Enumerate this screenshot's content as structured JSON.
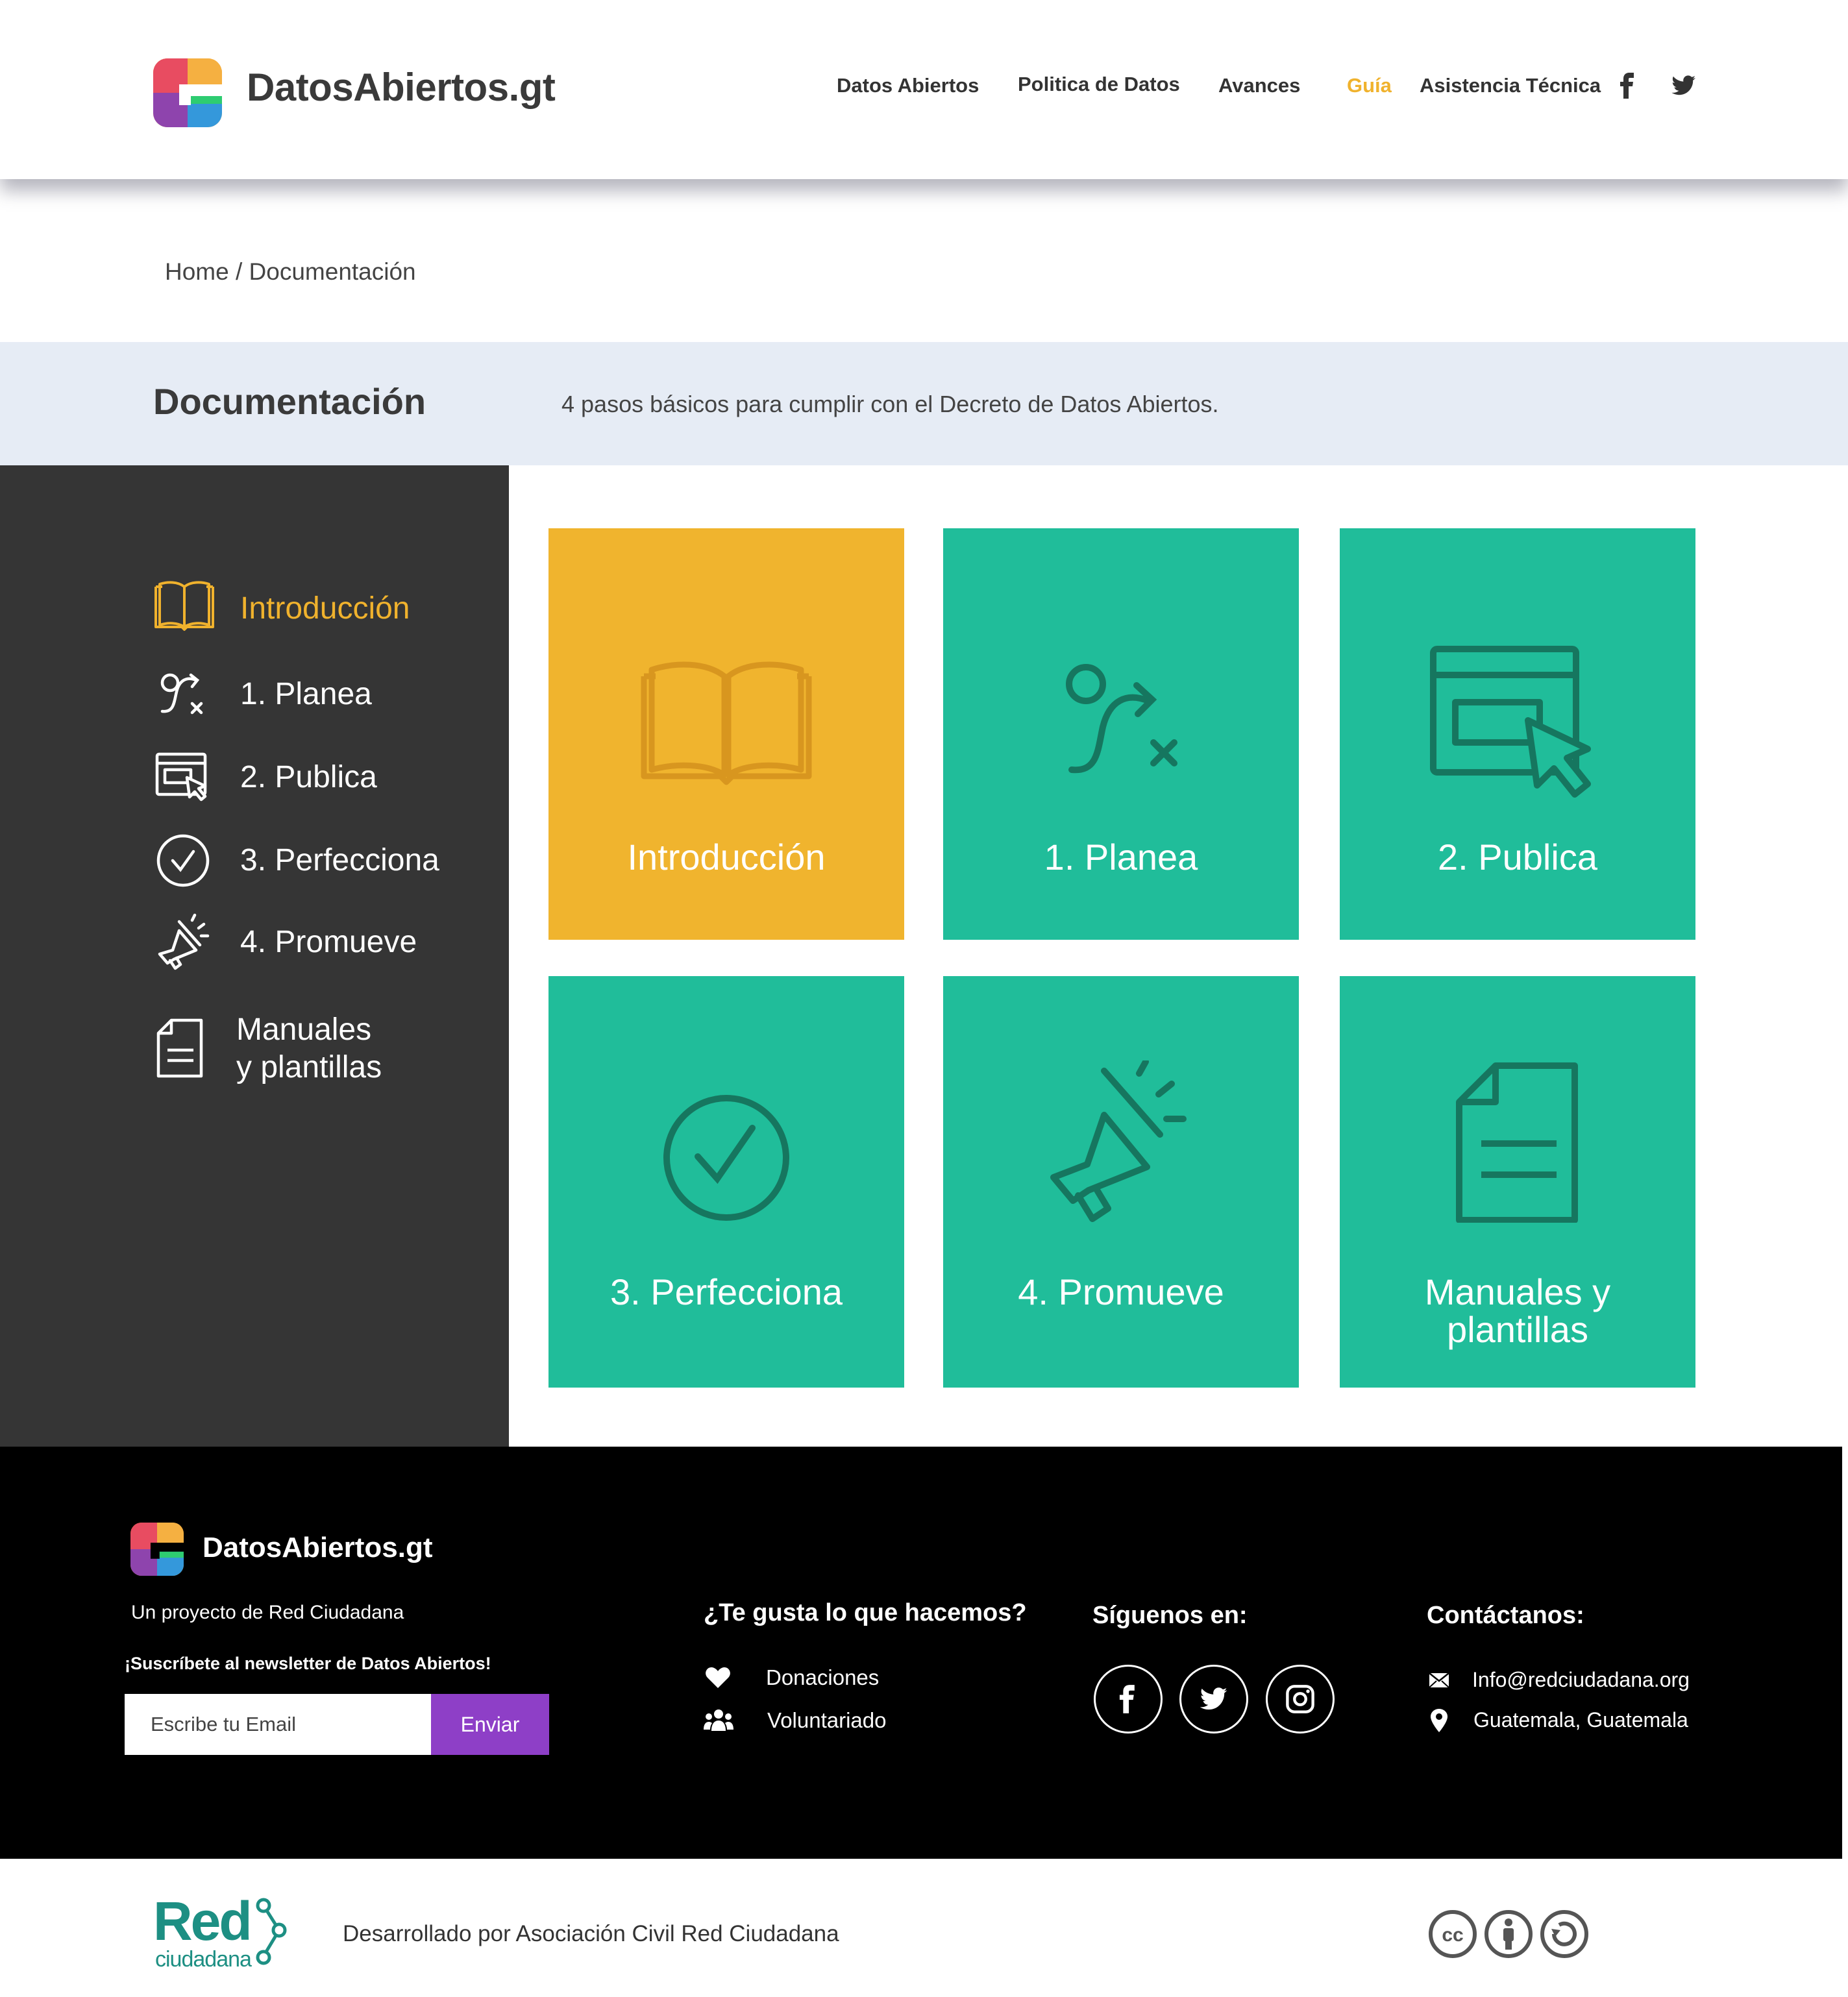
{
  "header": {
    "logo_text": "DatosAbiertos.gt",
    "nav": [
      "Datos Abiertos",
      "Politica de Datos",
      "Avances",
      "Guía",
      "Asistencia Técnica"
    ],
    "active_nav": "Guía",
    "social_icons": [
      "facebook-icon",
      "twitter-icon"
    ]
  },
  "breadcrumb": {
    "home": "Home",
    "separator": "/",
    "current": "Documentación"
  },
  "band": {
    "title": "Documentación",
    "subtitle": "4 pasos básicos para cumplir con el Decreto de Datos Abiertos."
  },
  "sidebar": {
    "items": [
      {
        "label": "Introducción",
        "icon": "book-icon",
        "active": true
      },
      {
        "label": "1. Planea",
        "icon": "route-icon"
      },
      {
        "label": "2. Publica",
        "icon": "browser-click-icon"
      },
      {
        "label": "3. Perfecciona",
        "icon": "check-circle-icon"
      },
      {
        "label": "4. Promueve",
        "icon": "megaphone-icon"
      },
      {
        "label_line1": "Manuales",
        "label_line2": "y plantillas",
        "icon": "document-icon"
      }
    ]
  },
  "tiles": [
    {
      "label": "Introducción",
      "icon": "book-icon",
      "color": "#f0b42e"
    },
    {
      "label": "1. Planea",
      "icon": "route-icon",
      "color": "#20bd9a"
    },
    {
      "label": "2. Publica",
      "icon": "browser-click-icon",
      "color": "#20bd9a"
    },
    {
      "label": "3. Perfecciona",
      "icon": "check-circle-icon",
      "color": "#20bd9a"
    },
    {
      "label": "4. Promueve",
      "icon": "megaphone-icon",
      "color": "#20bd9a"
    },
    {
      "label_line1": "Manuales y",
      "label_line2": "plantillas",
      "icon": "document-icon",
      "color": "#20bd9a"
    }
  ],
  "footer": {
    "logo_text": "DatosAbiertos.gt",
    "project": "Un proyecto de Red Ciudadana",
    "newsletter": "¡Suscríbete al newsletter de Datos Abiertos!",
    "email_placeholder": "Escribe tu Email",
    "send_label": "Enviar",
    "like_title": "¿Te gusta lo que hacemos?",
    "links": [
      {
        "label": "Donaciones",
        "icon": "heart-icon"
      },
      {
        "label": "Voluntariado",
        "icon": "people-icon"
      }
    ],
    "follow_title": "Síguenos en:",
    "social": [
      "facebook-icon",
      "twitter-icon",
      "instagram-icon"
    ],
    "contact_title": "Contáctanos:",
    "contacts": [
      {
        "label": "Info@redciudadana.org",
        "icon": "envelope-icon"
      },
      {
        "label": "Guatemala, Guatemala",
        "icon": "location-pin-icon"
      }
    ]
  },
  "bottom": {
    "rc_logo": "Red",
    "rc_logo_sub": "ciudadana",
    "developed_by": "Desarrollado por Asociación Civil Red Ciudadana",
    "license_icons": [
      "cc-icon",
      "by-icon",
      "share-alike-icon"
    ]
  },
  "colors": {
    "accent_yellow": "#f0b42e",
    "accent_green": "#20bd9a",
    "sidebar_bg": "#353535",
    "band_bg": "#e6ecf5",
    "send_button": "#8e3fc7",
    "rc_green": "#1d8f83"
  }
}
